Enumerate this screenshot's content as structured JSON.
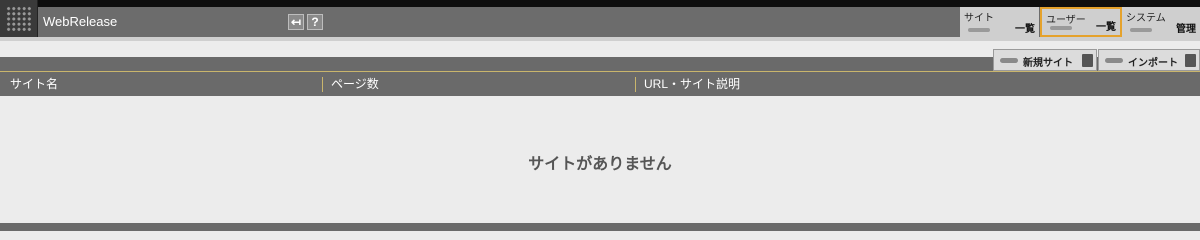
{
  "header": {
    "app_title": "WebRelease"
  },
  "nav": [
    {
      "category": "サイト",
      "action": "一覧"
    },
    {
      "category": "ユーザー",
      "action": "一覧"
    },
    {
      "category": "システム",
      "action": "管理"
    }
  ],
  "toolbar": {
    "new_site_label": "新規サイト",
    "import_label": "インポート"
  },
  "table": {
    "columns": [
      "サイト名",
      "ページ数",
      "URL・サイト説明"
    ],
    "rows": []
  },
  "empty_message": "サイトがありません",
  "colors": {
    "header_bg": "#6c6c6c",
    "active_nav_border": "#e5a22c",
    "table_header_bg": "#6a6a6a",
    "body_bg": "#ececec"
  },
  "icons": {
    "back": "back-arrow-icon",
    "help": "help-icon"
  }
}
